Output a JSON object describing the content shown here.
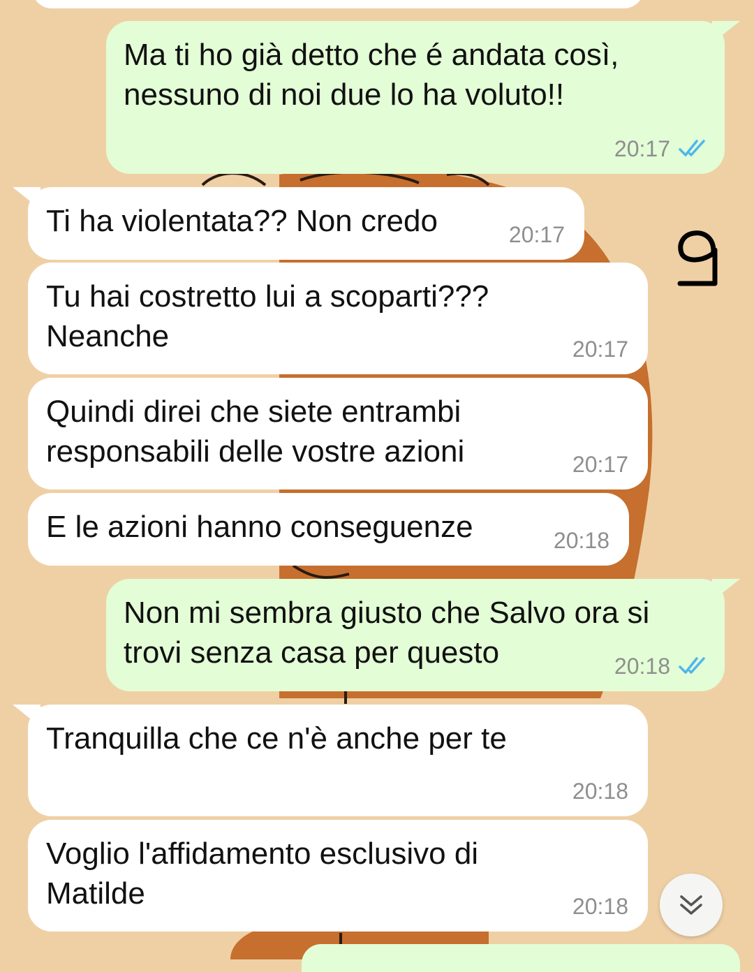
{
  "colors": {
    "wallpaper": "#efd0a5",
    "wallpaper_art": "#c66f2e",
    "incoming_bubble": "#ffffff",
    "outgoing_bubble": "#e3fdd6",
    "read_ticks": "#4fb6ec",
    "time_text": "#8e8e8e"
  },
  "annotation": {
    "text": "9"
  },
  "messages": [
    {
      "direction": "outgoing",
      "text": "Ma ti ho già detto che é andata così,\nnessuno di noi due lo ha voluto!!",
      "time": "20:17",
      "status_icon": "double-check-read-icon"
    },
    {
      "direction": "incoming",
      "text": "Ti ha violentata?? Non credo",
      "time": "20:17"
    },
    {
      "direction": "incoming",
      "text": "Tu hai costretto lui a scoparti???\nNeanche",
      "time": "20:17"
    },
    {
      "direction": "incoming",
      "text": "Quindi direi che siete entrambi\nresponsabili delle vostre azioni",
      "time": "20:17"
    },
    {
      "direction": "incoming",
      "text": "E le azioni hanno conseguenze",
      "time": "20:18"
    },
    {
      "direction": "outgoing",
      "text": "Non mi sembra giusto che Salvo ora si\ntrovi senza casa per questo",
      "time": "20:18",
      "status_icon": "double-check-read-icon"
    },
    {
      "direction": "incoming",
      "text": "Tranquilla che ce n'è anche per te",
      "time": "20:18"
    },
    {
      "direction": "incoming",
      "text": "Voglio l'affidamento esclusivo di\nMatilde",
      "time": "20:18"
    }
  ],
  "scroll_button": {
    "icon": "double-chevron-down-icon"
  }
}
